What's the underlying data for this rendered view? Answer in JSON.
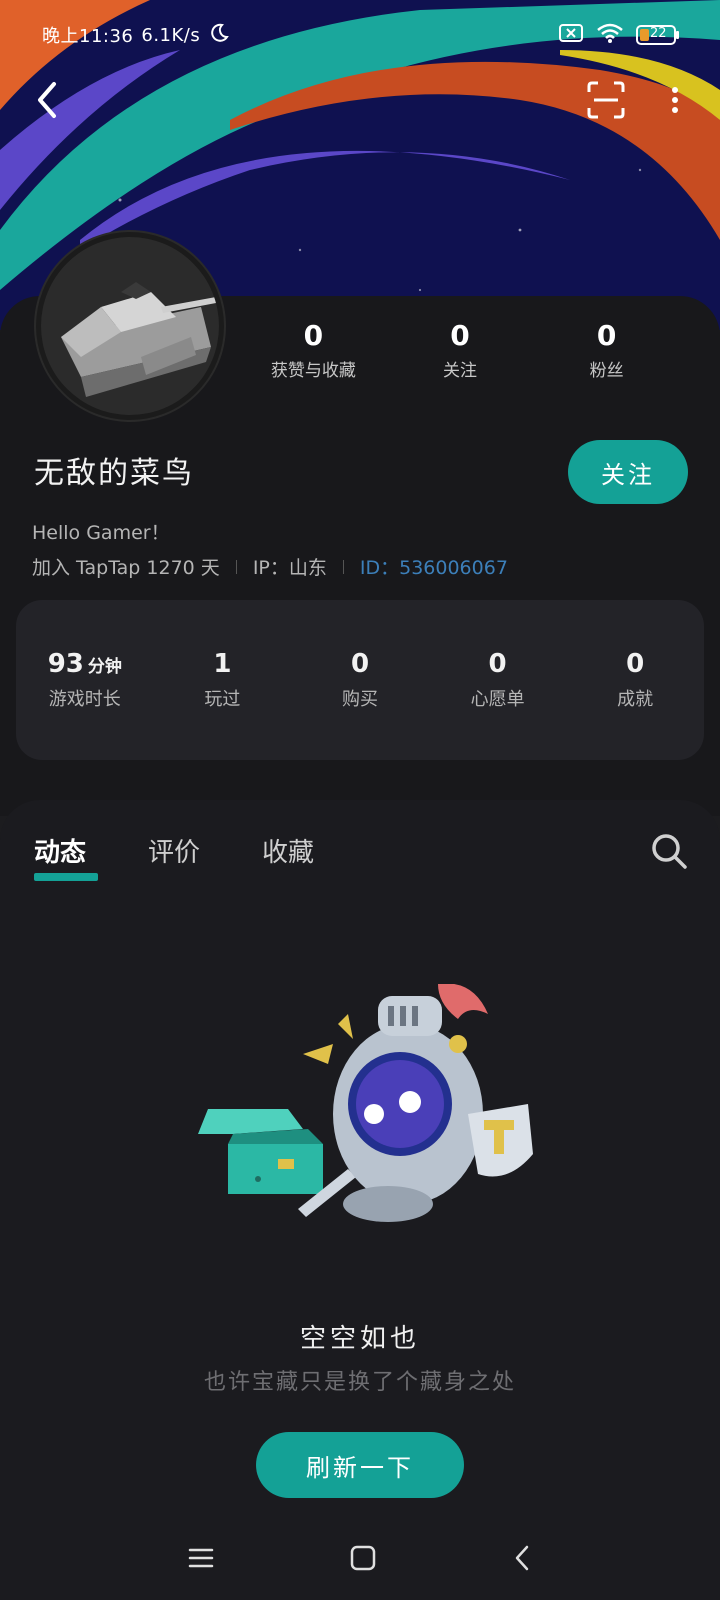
{
  "status_bar": {
    "time": "晚上11:36",
    "net_speed": "6.1K/s",
    "battery": "22"
  },
  "profile": {
    "username": "无敌的菜鸟",
    "follow_label": "关注",
    "bio": "Hello Gamer！",
    "join": "加入 TapTap 1270 天",
    "ip": "IP：山东",
    "id": "ID：536006067",
    "stats": [
      {
        "value": "0",
        "label": "获赞与收藏"
      },
      {
        "value": "0",
        "label": "关注"
      },
      {
        "value": "0",
        "label": "粉丝"
      }
    ]
  },
  "game_stats": [
    {
      "value": "93",
      "unit": "分钟",
      "label": "游戏时长"
    },
    {
      "value": "1",
      "unit": "",
      "label": "玩过"
    },
    {
      "value": "0",
      "unit": "",
      "label": "购买"
    },
    {
      "value": "0",
      "unit": "",
      "label": "心愿单"
    },
    {
      "value": "0",
      "unit": "",
      "label": "成就"
    }
  ],
  "tabs": [
    {
      "label": "动态",
      "active": true
    },
    {
      "label": "评价",
      "active": false
    },
    {
      "label": "收藏",
      "active": false
    }
  ],
  "empty_state": {
    "title": "空空如也",
    "subtitle": "也许宝藏只是换了个藏身之处",
    "refresh_label": "刷新一下"
  },
  "colors": {
    "accent": "#14a196",
    "banner_bg": "#0f1150",
    "id_link": "#3c7fb9"
  },
  "icons": {
    "back": "back-arrow-icon",
    "scan": "scan-icon",
    "more": "more-vertical-icon",
    "search": "search-icon"
  }
}
